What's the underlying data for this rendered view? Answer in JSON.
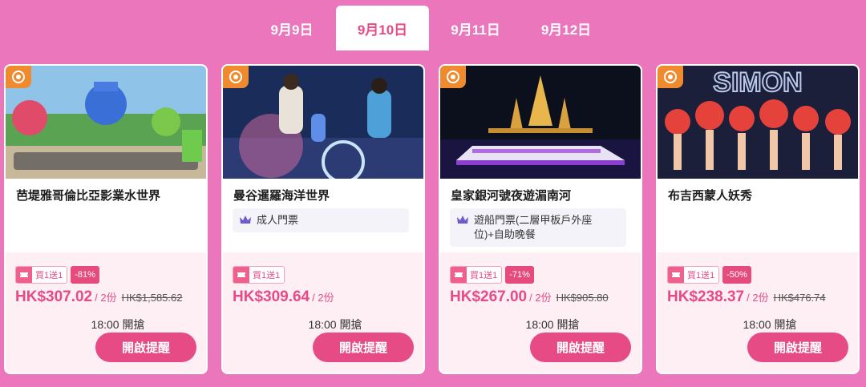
{
  "tabs": [
    {
      "label": "9月9日",
      "active": false
    },
    {
      "label": "9月10日",
      "active": true
    },
    {
      "label": "9月11日",
      "active": false
    },
    {
      "label": "9月12日",
      "active": false
    }
  ],
  "colors": {
    "background": "#ec76bb",
    "accent": "#e64b86",
    "badge": "#f08a2e",
    "bottom_panel": "#fdeff4"
  },
  "cards": [
    {
      "title": "芭堤雅哥倫比亞影業水世界",
      "option": "",
      "tag": "買1送1",
      "discount": "-81%",
      "price": "HK$307.02",
      "unit": "/ 2份",
      "original_price": "HK$1,585.62",
      "time": "18:00 開搶",
      "button": "開啟提醒",
      "image_icon": "waterpark-photo"
    },
    {
      "title": "曼谷暹羅海洋世界",
      "option": "成人門票",
      "tag": "買1送1",
      "discount": "",
      "price": "HK$309.64",
      "unit": "/ 2份",
      "original_price": "",
      "time": "18:00 開搶",
      "button": "開啟提醒",
      "image_icon": "aquarium-photo"
    },
    {
      "title": "皇家銀河號夜遊湄南河",
      "option": "遊船門票(二層甲板戶外座位)+自助晚餐",
      "tag": "買1送1",
      "discount": "-71%",
      "price": "HK$267.00",
      "unit": "/ 2份",
      "original_price": "HK$905.80",
      "time": "18:00 開搶",
      "button": "開啟提醒",
      "image_icon": "river-cruise-photo"
    },
    {
      "title": "布吉西蒙人妖秀",
      "option": "",
      "tag": "買1送1",
      "discount": "-50%",
      "price": "HK$238.37",
      "unit": "/ 2份",
      "original_price": "HK$476.74",
      "time": "18:00 開搶",
      "button": "開啟提醒",
      "image_icon": "cabaret-show-photo",
      "image_text": "SIMON"
    }
  ]
}
